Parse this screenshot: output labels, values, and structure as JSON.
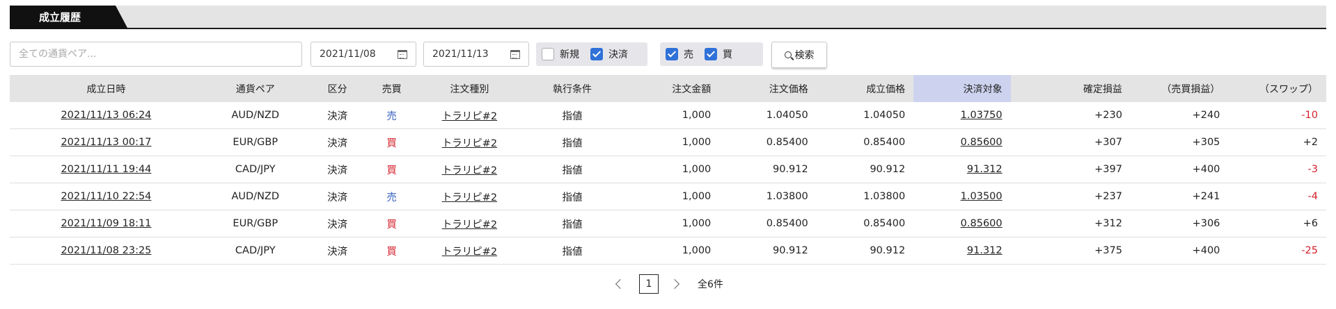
{
  "tab": {
    "label": "成立履歴"
  },
  "filters": {
    "pair_placeholder": "全ての通貨ペア...",
    "date_from": "2021/11/08",
    "date_to": "2021/11/13",
    "type_options": [
      {
        "label": "新規",
        "checked": false
      },
      {
        "label": "決済",
        "checked": true
      }
    ],
    "side_options": [
      {
        "label": "売",
        "checked": true
      },
      {
        "label": "買",
        "checked": true
      }
    ],
    "search_label": "検索"
  },
  "table": {
    "headers": [
      "成立日時",
      "通貨ペア",
      "区分",
      "売買",
      "注文種別",
      "執行条件",
      "注文金額",
      "注文価格",
      "成立価格",
      "決済対象",
      "確定損益",
      "（売買損益）",
      "（スワップ）"
    ],
    "rows": [
      {
        "datetime": "2021/11/13 06:24",
        "pair": "AUD/NZD",
        "kind": "決済",
        "side": "売",
        "order_type": "トラリピ#2",
        "condition": "指値",
        "amount": "1,000",
        "order_price": "1.04050",
        "fill_price": "1.04050",
        "target": "1.03750",
        "pnl": "+230",
        "trade_pnl": "+240",
        "swap": "-10"
      },
      {
        "datetime": "2021/11/13 00:17",
        "pair": "EUR/GBP",
        "kind": "決済",
        "side": "買",
        "order_type": "トラリピ#2",
        "condition": "指値",
        "amount": "1,000",
        "order_price": "0.85400",
        "fill_price": "0.85400",
        "target": "0.85600",
        "pnl": "+307",
        "trade_pnl": "+305",
        "swap": "+2"
      },
      {
        "datetime": "2021/11/11 19:44",
        "pair": "CAD/JPY",
        "kind": "決済",
        "side": "買",
        "order_type": "トラリピ#2",
        "condition": "指値",
        "amount": "1,000",
        "order_price": "90.912",
        "fill_price": "90.912",
        "target": "91.312",
        "pnl": "+397",
        "trade_pnl": "+400",
        "swap": "-3"
      },
      {
        "datetime": "2021/11/10 22:54",
        "pair": "AUD/NZD",
        "kind": "決済",
        "side": "売",
        "order_type": "トラリピ#2",
        "condition": "指値",
        "amount": "1,000",
        "order_price": "1.03800",
        "fill_price": "1.03800",
        "target": "1.03500",
        "pnl": "+237",
        "trade_pnl": "+241",
        "swap": "-4"
      },
      {
        "datetime": "2021/11/09 18:11",
        "pair": "EUR/GBP",
        "kind": "決済",
        "side": "買",
        "order_type": "トラリピ#2",
        "condition": "指値",
        "amount": "1,000",
        "order_price": "0.85400",
        "fill_price": "0.85400",
        "target": "0.85600",
        "pnl": "+312",
        "trade_pnl": "+306",
        "swap": "+6"
      },
      {
        "datetime": "2021/11/08 23:25",
        "pair": "CAD/JPY",
        "kind": "決済",
        "side": "買",
        "order_type": "トラリピ#2",
        "condition": "指値",
        "amount": "1,000",
        "order_price": "90.912",
        "fill_price": "90.912",
        "target": "91.312",
        "pnl": "+375",
        "trade_pnl": "+400",
        "swap": "-25"
      }
    ]
  },
  "pager": {
    "page": "1",
    "total": "全6件"
  },
  "colors": {
    "sell": "#3a64c0",
    "buy": "#d4202c",
    "negative": "#d4202c",
    "checkbox": "#2f71d8",
    "highlight_header": "#cdd3ef"
  }
}
